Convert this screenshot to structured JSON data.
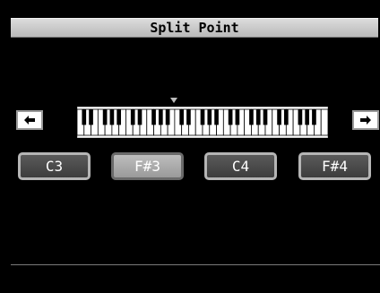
{
  "title": "Split Point",
  "nav": {
    "left_icon": "arrow-left-icon",
    "right_icon": "arrow-right-icon"
  },
  "split_indicator_icon": "triangle-down-icon",
  "keyboard": {
    "white_keys": 36,
    "split_key_index": 12
  },
  "options": [
    {
      "label": "C3",
      "selected": false
    },
    {
      "label": "F#3",
      "selected": true
    },
    {
      "label": "C4",
      "selected": false
    },
    {
      "label": "F#4",
      "selected": false
    }
  ],
  "colors": {
    "background": "#000000",
    "title_bar": "#c8c8c8",
    "selected_button": "#aaaaaa",
    "button": "#4a4a4a"
  }
}
